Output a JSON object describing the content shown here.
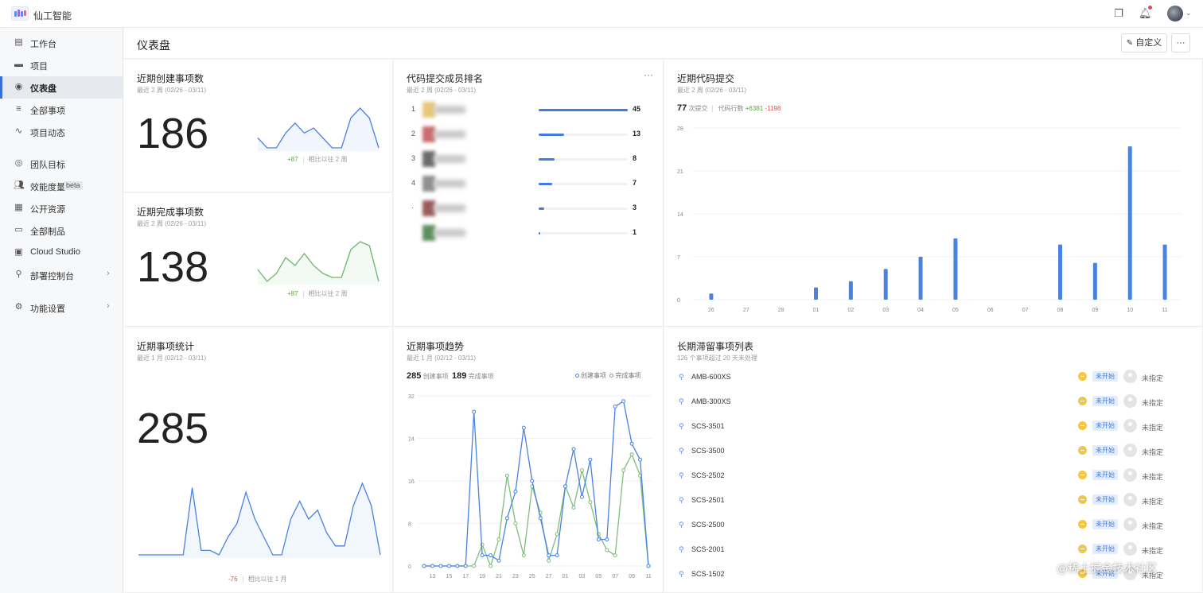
{
  "app": {
    "title": "仙工智能"
  },
  "sidebar": {
    "items": [
      {
        "label": "工作台",
        "icon": "workbench-icon"
      },
      {
        "label": "项目",
        "icon": "folder-icon"
      },
      {
        "label": "仪表盘",
        "icon": "dashboard-icon",
        "active": true
      },
      {
        "label": "全部事项",
        "icon": "filter-icon"
      },
      {
        "label": "项目动态",
        "icon": "activity-icon"
      },
      {
        "label": "团队目标",
        "icon": "target-icon"
      },
      {
        "label": "效能度量",
        "icon": "people-icon",
        "badge": "beta"
      },
      {
        "label": "公开资源",
        "icon": "grid-icon"
      },
      {
        "label": "全部制品",
        "icon": "artifact-icon"
      },
      {
        "label": "Cloud Studio",
        "icon": "studio-icon"
      },
      {
        "label": "部署控制台",
        "icon": "deploy-icon",
        "arrow": "›"
      },
      {
        "label": "功能设置",
        "icon": "settings-icon",
        "arrow": "›"
      }
    ]
  },
  "header": {
    "title": "仪表盘",
    "customize_label": "自定义",
    "more_label": "···"
  },
  "cards": {
    "created": {
      "title": "近期创建事项数",
      "subtitle": "最近 2 周 (02/26 - 03/11)",
      "value": "186",
      "delta": "+87",
      "compare": "相比以往 2 周",
      "sparkline": [
        8,
        6,
        6,
        9,
        11,
        9,
        10,
        8,
        6,
        6,
        12,
        14,
        12,
        6
      ]
    },
    "completed": {
      "title": "近期完成事项数",
      "subtitle": "最近 2 周 (02/26 - 03/11)",
      "value": "138",
      "delta": "+87",
      "compare": "相比以往 2 周",
      "sparkline": [
        8,
        5,
        7,
        11,
        9,
        12,
        9,
        7,
        6,
        6,
        13,
        15,
        14,
        5
      ]
    },
    "stats": {
      "title": "近期事项统计",
      "subtitle": "最近 1 月 (02/12 - 03/11)",
      "value": "285",
      "delta": "-76",
      "compare": "相比以往 1 月",
      "sparkline": [
        0,
        0,
        0,
        0,
        0,
        0,
        15,
        1,
        1,
        0,
        4,
        7,
        14,
        8,
        4,
        0,
        0,
        8,
        12,
        8,
        10,
        5,
        2,
        2,
        11,
        16,
        11,
        0
      ]
    },
    "rank": {
      "title": "代码提交成员排名",
      "subtitle": "最近 2 周 (02/26 - 03/11)",
      "more": "···",
      "rows": [
        {
          "rank": "1",
          "value": 45,
          "label": "45"
        },
        {
          "rank": "2",
          "value": 13,
          "label": "13"
        },
        {
          "rank": "3",
          "value": 8,
          "label": "8"
        },
        {
          "rank": "4",
          "value": 7,
          "label": "7"
        },
        {
          "rank": "·",
          "value": 3,
          "label": "3"
        },
        {
          "rank": "",
          "value": 1,
          "label": "1"
        }
      ]
    },
    "commits": {
      "title": "近期代码提交",
      "subtitle": "最近 2 周 (02/26 - 03/11)",
      "count": "77",
      "count_label": "次提交",
      "lines_label": "代码行数",
      "added": "+6381",
      "removed": "-1198"
    },
    "trend": {
      "title": "近期事项趋势",
      "subtitle": "最近 1 月 (02/12 - 03/11)",
      "created_total": "285",
      "created_label": "创建事项",
      "completed_total": "189",
      "completed_label": "完成事项",
      "legend_created": "创建事项",
      "legend_completed": "完成事项"
    },
    "stale": {
      "title": "长期滞留事项列表",
      "subtitle": "126 个事项超过 20 天未处理",
      "items": [
        {
          "id": "AMB-600XS",
          "status": "未开始",
          "assignee": "未指定"
        },
        {
          "id": "AMB-300XS",
          "status": "未开始",
          "assignee": "未指定"
        },
        {
          "id": "SCS-3501",
          "status": "未开始",
          "assignee": "未指定"
        },
        {
          "id": "SCS-3500",
          "status": "未开始",
          "assignee": "未指定"
        },
        {
          "id": "SCS-2502",
          "status": "未开始",
          "assignee": "未指定"
        },
        {
          "id": "SCS-2501",
          "status": "未开始",
          "assignee": "未指定"
        },
        {
          "id": "SCS-2500",
          "status": "未开始",
          "assignee": "未指定"
        },
        {
          "id": "SCS-2001",
          "status": "未开始",
          "assignee": "未指定"
        },
        {
          "id": "SCS-1502",
          "status": "未开始",
          "assignee": "未指定"
        }
      ]
    }
  },
  "chart_data": [
    {
      "type": "bar",
      "categories": [
        "26",
        "27",
        "28",
        "01",
        "02",
        "03",
        "04",
        "05",
        "06",
        "07",
        "08",
        "09",
        "10",
        "11"
      ],
      "values": [
        1,
        0,
        0,
        2,
        3,
        5,
        7,
        10,
        0,
        0,
        9,
        6,
        25,
        9
      ],
      "ylim": [
        0,
        28
      ],
      "yticks": [
        0,
        7,
        14,
        21,
        28
      ],
      "color": "#4a82e0"
    },
    {
      "type": "line",
      "x": [
        "12",
        "13",
        "14",
        "15",
        "16",
        "17",
        "18",
        "19",
        "20",
        "21",
        "22",
        "23",
        "24",
        "25",
        "26",
        "27",
        "28",
        "01",
        "02",
        "03",
        "04",
        "05",
        "06",
        "07",
        "08",
        "09",
        "10",
        "11"
      ],
      "xticks": [
        "13",
        "15",
        "17",
        "19",
        "21",
        "23",
        "25",
        "27",
        "01",
        "03",
        "05",
        "07",
        "09",
        "11"
      ],
      "ylim": [
        0,
        32
      ],
      "yticks": [
        0,
        8,
        16,
        24,
        32
      ],
      "series": [
        {
          "name": "创建事项",
          "color": "#4a82e0",
          "values": [
            0,
            0,
            0,
            0,
            0,
            0,
            29,
            2,
            2,
            1,
            9,
            14,
            26,
            16,
            9,
            2,
            2,
            15,
            22,
            13,
            20,
            5,
            5,
            30,
            31,
            23,
            20,
            0
          ]
        },
        {
          "name": "完成事项",
          "color": "#7cbf7a",
          "values": [
            0,
            0,
            0,
            0,
            0,
            0,
            0,
            4,
            0,
            5,
            17,
            8,
            2,
            15,
            10,
            1,
            6,
            15,
            11,
            18,
            12,
            6,
            3,
            2,
            18,
            21,
            17,
            0
          ]
        }
      ]
    }
  ],
  "watermark": "@稀土掘金技术社区"
}
